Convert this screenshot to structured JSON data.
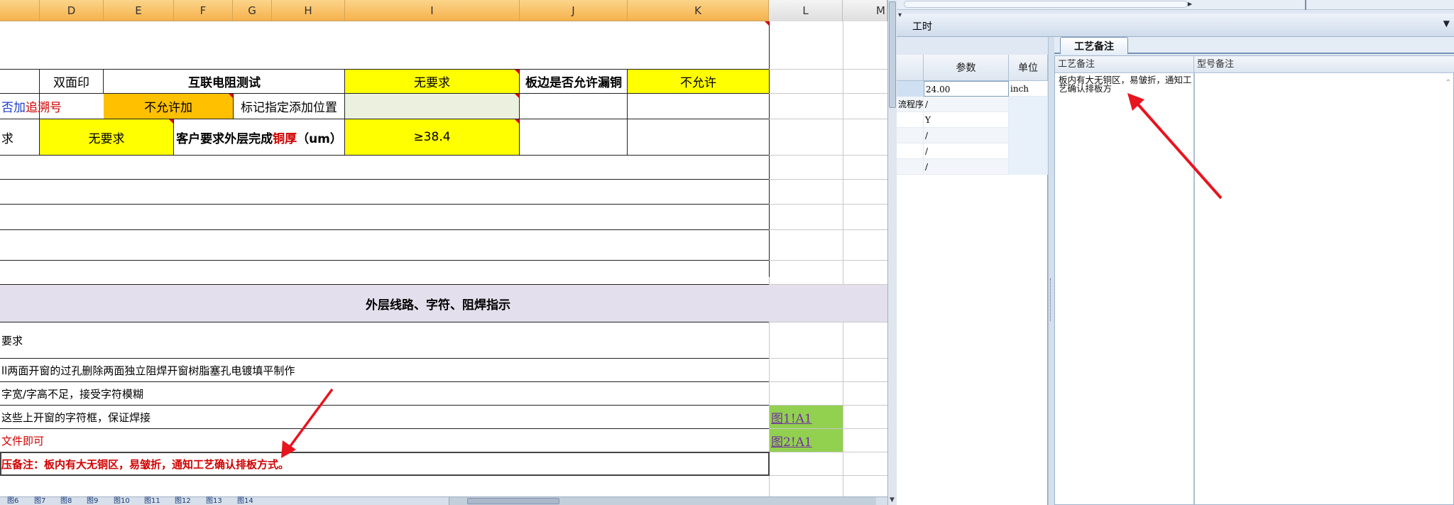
{
  "sheet": {
    "columns": [
      "D",
      "E",
      "F",
      "G",
      "H",
      "I",
      "J",
      "K",
      "L",
      "M"
    ],
    "row1": {
      "d": "双面印",
      "efgh": "互联电阻测试",
      "i": "无要求",
      "j": "板边是否允许漏铜",
      "k": "不允许"
    },
    "row2": {
      "a_part1": "否加",
      "a_part2": "追溯号",
      "ef": "不允许加",
      "gh": "标记指定添加位置"
    },
    "row3": {
      "a": "求",
      "de": "无要求",
      "fgh_part1": "客户要求外层完成",
      "fgh_part2": "铜厚",
      "fgh_part3": "（um）",
      "i": "≥38.4"
    },
    "section_title": "外层线路、字符、阻焊指示",
    "notes": [
      "要求",
      "ll两面开窗的过孔删除两面独立阻焊开窗树脂塞孔电镀填平制作",
      "字宽/字高不足，接受字符模糊",
      "这些上开窗的字符框，保证焊接",
      "文件即可",
      "压备注：板内有大无铜区，易皱折，通知工艺确认排板方式。"
    ],
    "links": [
      "图1!A1",
      "图2!A1"
    ],
    "sheet_tabs": [
      "图6",
      "图7",
      "图8",
      "图9",
      "图10",
      "图11",
      "图12",
      "图13",
      "图14"
    ]
  },
  "panel": {
    "top_label": "工时",
    "param_headers": {
      "param": "参数",
      "unit": "单位"
    },
    "param_rows": [
      {
        "label": "",
        "value": "24.00",
        "unit": "inch"
      },
      {
        "label": "流程序",
        "value": "/",
        "unit": ""
      },
      {
        "label": "",
        "value": "Y",
        "unit": ""
      },
      {
        "label": "",
        "value": "/",
        "unit": ""
      },
      {
        "label": "",
        "value": "/",
        "unit": ""
      },
      {
        "label": "",
        "value": "/",
        "unit": ""
      }
    ],
    "tab_label": "工艺备注",
    "notes_headers": {
      "process": "工艺备注",
      "model": "型号备注"
    },
    "process_note": "板内有大无铜区，易皱折，通知工艺确认排板方"
  },
  "colors": {
    "header_orange": "#f6b24c",
    "yellow": "#ffff00",
    "orange": "#ffc000",
    "lavender": "#e4dfec",
    "link_green": "#92d050",
    "arrow_red": "#e8141e"
  }
}
